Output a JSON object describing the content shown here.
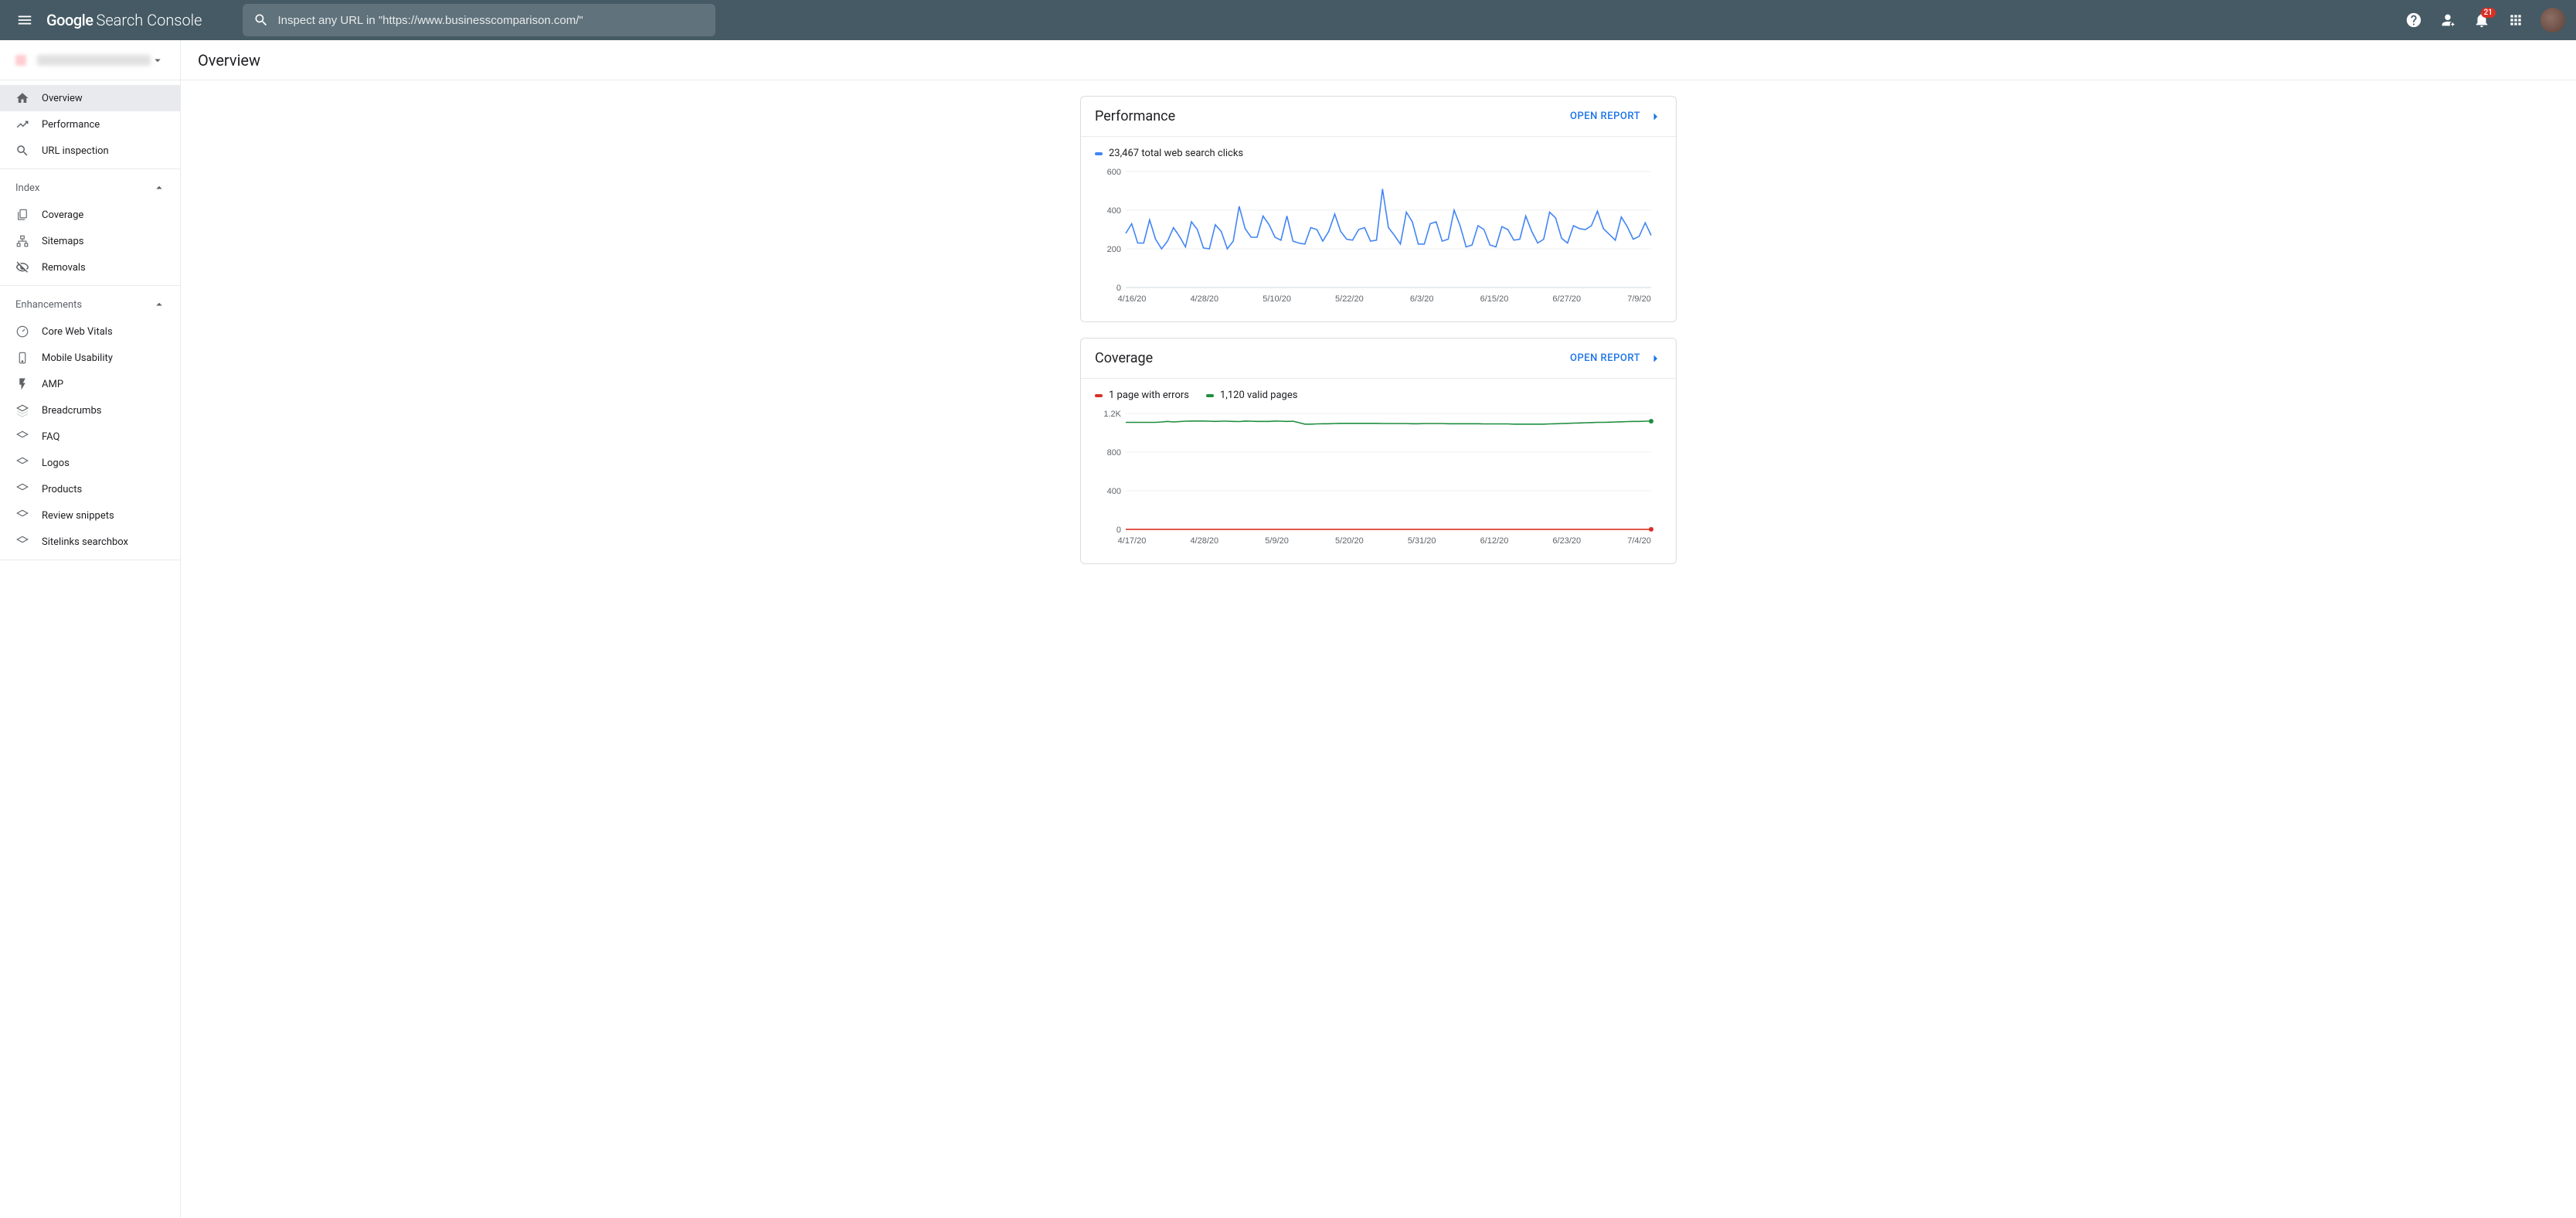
{
  "header": {
    "app_name_1": "Google",
    "app_name_2": "Search Console",
    "search_placeholder": "Inspect any URL in \"https://www.businesscomparison.com/\"",
    "notifications_badge": "21"
  },
  "page": {
    "title": "Overview"
  },
  "sidebar": {
    "overview": "Overview",
    "performance": "Performance",
    "url_inspection": "URL inspection",
    "section_index": "Index",
    "coverage": "Coverage",
    "sitemaps": "Sitemaps",
    "removals": "Removals",
    "section_enhancements": "Enhancements",
    "core_web_vitals": "Core Web Vitals",
    "mobile_usability": "Mobile Usability",
    "amp": "AMP",
    "breadcrumbs": "Breadcrumbs",
    "faq": "FAQ",
    "logos": "Logos",
    "products": "Products",
    "review_snippets": "Review snippets",
    "sitelinks_searchbox": "Sitelinks searchbox"
  },
  "cards": {
    "performance": {
      "title": "Performance",
      "open_report": "OPEN REPORT",
      "legend": "23,467 total web search clicks"
    },
    "coverage": {
      "title": "Coverage",
      "open_report": "OPEN REPORT",
      "legend_errors": "1 page with errors",
      "legend_valid": "1,120 valid pages"
    }
  },
  "chart_data": [
    {
      "id": "performance",
      "type": "line",
      "xlabel": "",
      "ylabel": "",
      "ylim": [
        0,
        600
      ],
      "yticks": [
        0,
        200,
        400,
        600
      ],
      "x_tick_labels": [
        "4/16/20",
        "4/28/20",
        "5/10/20",
        "5/22/20",
        "6/3/20",
        "6/15/20",
        "6/27/20",
        "7/9/20"
      ],
      "series": [
        {
          "name": "clicks",
          "color": "#4285f4",
          "values": [
            280,
            330,
            230,
            230,
            350,
            250,
            200,
            240,
            310,
            265,
            210,
            340,
            300,
            205,
            200,
            325,
            290,
            200,
            240,
            420,
            305,
            260,
            260,
            370,
            325,
            260,
            245,
            370,
            240,
            230,
            225,
            310,
            300,
            240,
            290,
            380,
            290,
            250,
            245,
            300,
            310,
            240,
            245,
            510,
            310,
            270,
            225,
            390,
            340,
            225,
            225,
            330,
            340,
            240,
            250,
            400,
            320,
            210,
            220,
            320,
            300,
            220,
            210,
            315,
            300,
            245,
            250,
            370,
            290,
            230,
            250,
            390,
            360,
            255,
            230,
            320,
            305,
            300,
            320,
            395,
            305,
            275,
            245,
            365,
            315,
            250,
            265,
            335,
            270
          ]
        }
      ]
    },
    {
      "id": "coverage",
      "type": "line",
      "xlabel": "",
      "ylabel": "",
      "ylim": [
        0,
        1200
      ],
      "yticks": [
        0,
        400,
        800,
        1200
      ],
      "ytick_labels": [
        "0",
        "400",
        "800",
        "1.2K"
      ],
      "x_tick_labels": [
        "4/17/20",
        "4/28/20",
        "5/9/20",
        "5/20/20",
        "5/31/20",
        "6/12/20",
        "6/23/20",
        "7/4/20"
      ],
      "series": [
        {
          "name": "errors",
          "color": "#d93025",
          "values": [
            1,
            1,
            1,
            1,
            1,
            1,
            1,
            1,
            1,
            1,
            1,
            1,
            1,
            1,
            1,
            1,
            1,
            1,
            1,
            1,
            1,
            1,
            1,
            1,
            1,
            1,
            1,
            1,
            1,
            1,
            1,
            1,
            1,
            1,
            1,
            1,
            1,
            1,
            1,
            1,
            1,
            1,
            1,
            1,
            1,
            1,
            1,
            1,
            1,
            1,
            1,
            1,
            1,
            1,
            1,
            1,
            1,
            1,
            1,
            1,
            1,
            1,
            1,
            1,
            1,
            1,
            1,
            1,
            1,
            1,
            1,
            1,
            1,
            1,
            1,
            1,
            1,
            1,
            1,
            1,
            1,
            1,
            1,
            1,
            1,
            1,
            1,
            1,
            1
          ]
        },
        {
          "name": "valid",
          "color": "#1e8e3e",
          "values": [
            1108,
            1108,
            1108,
            1108,
            1108,
            1108,
            1112,
            1118,
            1112,
            1116,
            1120,
            1122,
            1122,
            1122,
            1120,
            1118,
            1120,
            1120,
            1118,
            1116,
            1122,
            1120,
            1118,
            1118,
            1118,
            1122,
            1120,
            1118,
            1120,
            1105,
            1090,
            1090,
            1092,
            1094,
            1094,
            1096,
            1098,
            1098,
            1098,
            1098,
            1098,
            1098,
            1098,
            1096,
            1096,
            1096,
            1096,
            1096,
            1094,
            1094,
            1096,
            1096,
            1096,
            1096,
            1094,
            1094,
            1094,
            1094,
            1094,
            1094,
            1092,
            1092,
            1092,
            1092,
            1092,
            1090,
            1090,
            1090,
            1090,
            1090,
            1090,
            1092,
            1094,
            1096,
            1098,
            1100,
            1102,
            1104,
            1106,
            1108,
            1108,
            1110,
            1112,
            1114,
            1116,
            1118,
            1118,
            1120,
            1120
          ]
        }
      ]
    }
  ]
}
